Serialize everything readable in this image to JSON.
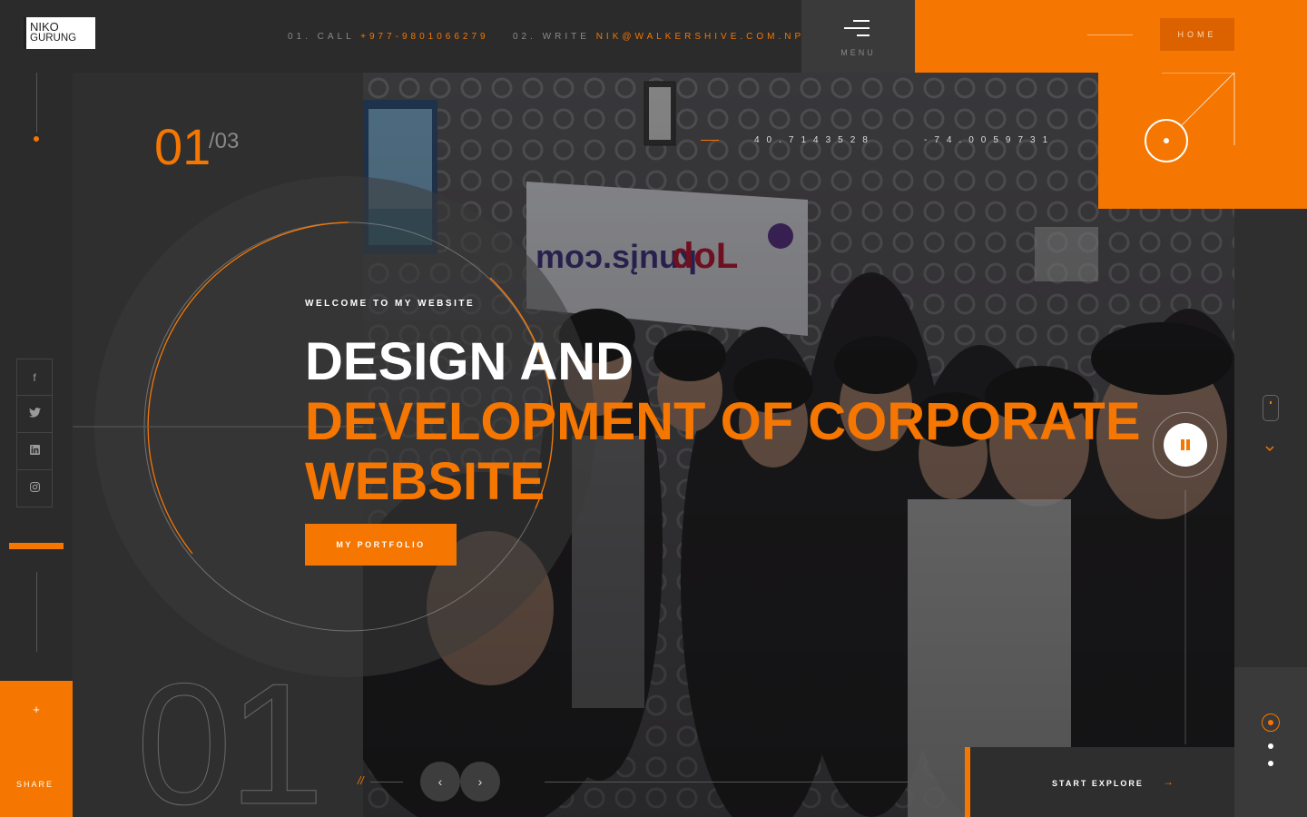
{
  "header": {
    "logo_line1": "NIKO",
    "logo_line2": "GURUNG",
    "call_label": "01. CALL",
    "call_value": "+977-9801066279",
    "write_label": "02. WRITE",
    "write_value": "NIK@WALKERSHIVE.COM.NP",
    "menu_label": "MENU",
    "home_label": "HOME"
  },
  "social": [
    {
      "name": "facebook-icon",
      "glyph": "f"
    },
    {
      "name": "twitter-icon",
      "glyph": "t"
    },
    {
      "name": "linkedin-icon",
      "glyph": "in"
    },
    {
      "name": "instagram-icon",
      "glyph": "◎"
    }
  ],
  "share": {
    "plus": "+",
    "label": "SHARE"
  },
  "slider": {
    "current": "01",
    "total": "/03",
    "big_number": "01"
  },
  "coords": {
    "lat": "40.7143528",
    "lng": "-74.0059731"
  },
  "hero": {
    "welcome": "WELCOME TO MY WEBSITE",
    "title_line1": "DESIGN AND",
    "title_line2": "DEVELOPMENT OF CORPORATE",
    "title_line3": "WEBSITE",
    "button": "MY PORTFOLIO"
  },
  "nav": {
    "slash": "//",
    "prev": "‹",
    "next": "›"
  },
  "explore": {
    "label": "START EXPLORE",
    "arrow": "→"
  },
  "colors": {
    "accent": "#f57600",
    "background": "#2b2b2b"
  }
}
